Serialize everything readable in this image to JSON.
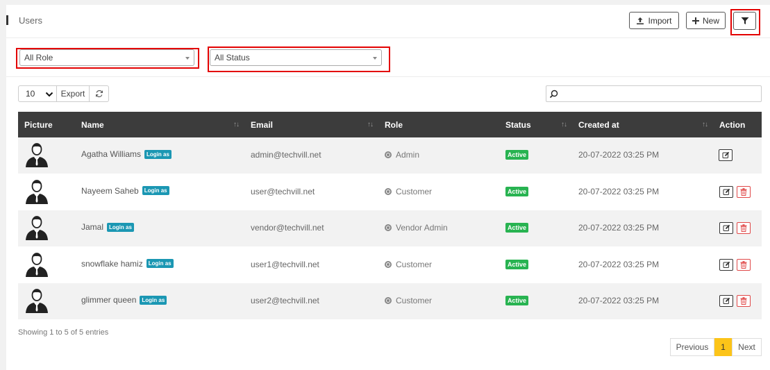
{
  "header": {
    "title": "Users",
    "import_label": "Import",
    "new_label": "New",
    "filter_icon": "filter-icon"
  },
  "filters": {
    "role": {
      "value": "All Role"
    },
    "status": {
      "value": "All Status"
    }
  },
  "toolbar": {
    "page_length": "10",
    "export_label": "Export",
    "search_value": ""
  },
  "table": {
    "columns": [
      "Picture",
      "Name",
      "Email",
      "Role",
      "Status",
      "Created at",
      "Action"
    ],
    "rows": [
      {
        "name": "Agatha Williams",
        "login": "Login as",
        "email": "admin@techvill.net",
        "role": "Admin",
        "status": "Active",
        "created": "20-07-2022 03:25 PM",
        "deletable": false
      },
      {
        "name": "Nayeem Saheb",
        "login": "Login as",
        "email": "user@techvill.net",
        "role": "Customer",
        "status": "Active",
        "created": "20-07-2022 03:25 PM",
        "deletable": true
      },
      {
        "name": "Jamal",
        "login": "Login as",
        "email": "vendor@techvill.net",
        "role": "Vendor Admin",
        "status": "Active",
        "created": "20-07-2022 03:25 PM",
        "deletable": true
      },
      {
        "name": "snowflake hamiz",
        "login": "Login as",
        "email": "user1@techvill.net",
        "role": "Customer",
        "status": "Active",
        "created": "20-07-2022 03:25 PM",
        "deletable": true
      },
      {
        "name": "glimmer queen",
        "login": "Login as",
        "email": "user2@techvill.net",
        "role": "Customer",
        "status": "Active",
        "created": "20-07-2022 03:25 PM",
        "deletable": true
      }
    ]
  },
  "footer": {
    "info": "Showing 1 to 5 of 5 entries",
    "previous": "Previous",
    "current_page": "1",
    "next": "Next"
  },
  "colors": {
    "header_bg": "#3c3c3c",
    "active_badge": "#28b351",
    "login_badge": "#1b97b3",
    "highlight": "#e30000",
    "page_active": "#fcc419"
  }
}
